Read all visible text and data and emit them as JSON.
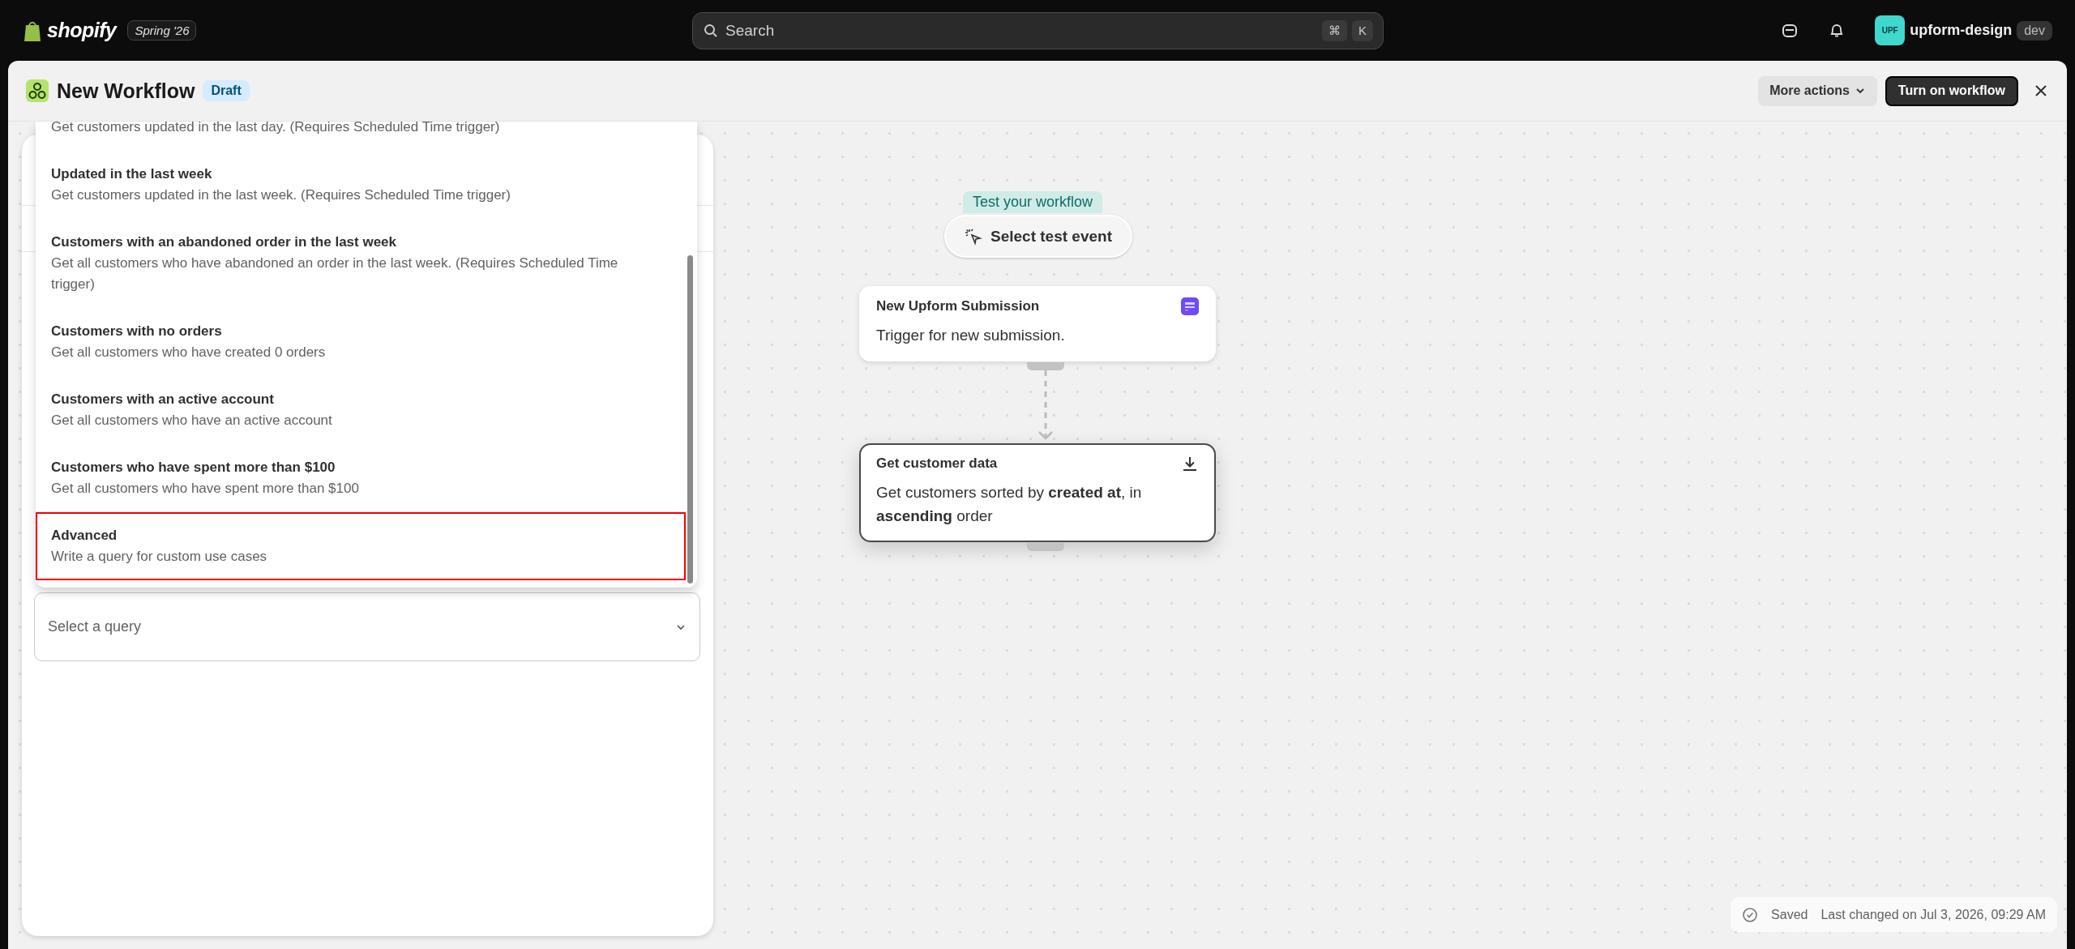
{
  "topbar": {
    "logo": "shopify",
    "edition": "Spring '26",
    "search": {
      "placeholder": "Search",
      "shortcut": [
        "⌘",
        "K"
      ]
    },
    "account": {
      "avatar": "UPF",
      "name": "upform-design",
      "badge": "dev"
    }
  },
  "header": {
    "title": "New Workflow",
    "status": "Draft",
    "buttons": [
      {
        "label": "More actions",
        "kind": "menu"
      },
      {
        "label": "Turn on workflow",
        "kind": "primary"
      }
    ]
  },
  "query_menu": {
    "items": [
      {
        "description": "Get customers updated in the last day. (Requires Scheduled Time trigger)",
        "selected": false
      },
      {
        "title": "Updated in the last week",
        "description": "Get customers updated in the last week. (Requires Scheduled Time trigger)",
        "selected": false
      },
      {
        "title": "Customers with an abandoned order in the last week",
        "description": "Get all customers who have abandoned an order in the last week. (Requires Scheduled Time trigger)",
        "selected": false
      },
      {
        "title": "Customers with no orders",
        "description": "Get all customers who have created 0 orders",
        "selected": false
      },
      {
        "title": "Customers with an active account",
        "description": "Get all customers who have an active account",
        "selected": false
      },
      {
        "title": "Customers who have spent more than $100",
        "description": "Get all customers who have spent more than $100",
        "selected": false
      },
      {
        "title": "Advanced",
        "description": "Write a query for custom use cases",
        "selected": true
      }
    ]
  },
  "query_select": {
    "placeholder": "Select a query"
  },
  "canvas": {
    "test_label": "Test your workflow",
    "test_button": "Select test event",
    "nodes": [
      {
        "kind": "trigger",
        "title": "New Upform Submission",
        "description": "Trigger for new submission.",
        "selected": false
      },
      {
        "kind": "action",
        "title": "Get customer data",
        "description": "Get customers sorted by **created at**, in **ascending** order",
        "selected": true
      }
    ]
  },
  "status": {
    "state": "Saved",
    "detail": "Last changed on Jul 3, 2026, 09:29 AM"
  }
}
